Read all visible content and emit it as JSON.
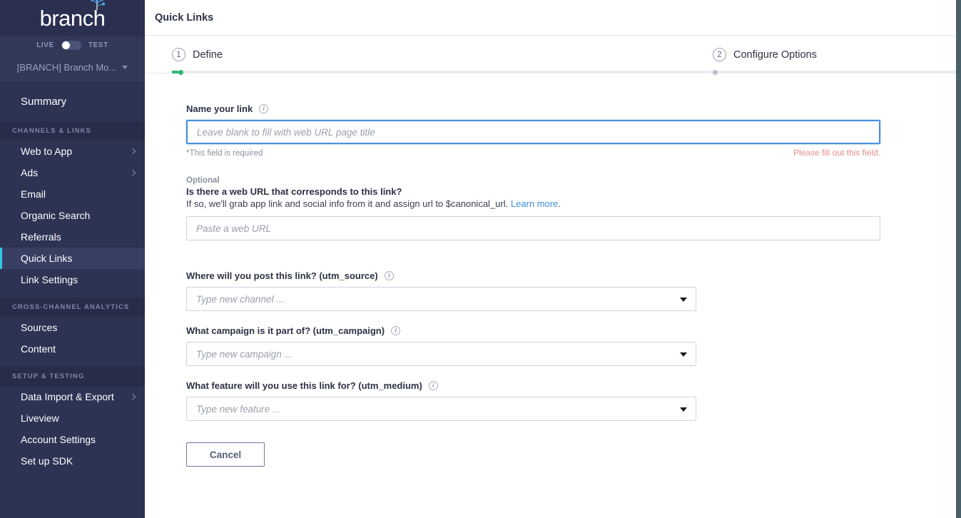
{
  "brand": {
    "logo_text": "branch",
    "accent_color": "#2ec7e4",
    "sidebar_bg": "#2d3353"
  },
  "sidebar": {
    "env_toggle": {
      "left_label": "LIVE",
      "right_label": "TEST",
      "state": "LIVE"
    },
    "account": {
      "label": "[BRANCH] Branch Mo...",
      "icon": "chevron-down-icon"
    },
    "top_items": [
      {
        "label": "Summary",
        "active": false,
        "expandable": false
      }
    ],
    "sections": [
      {
        "title": "CHANNELS & LINKS",
        "items": [
          {
            "label": "Web to App",
            "active": false,
            "expandable": true
          },
          {
            "label": "Ads",
            "active": false,
            "expandable": true
          },
          {
            "label": "Email",
            "active": false,
            "expandable": false
          },
          {
            "label": "Organic Search",
            "active": false,
            "expandable": false
          },
          {
            "label": "Referrals",
            "active": false,
            "expandable": false
          },
          {
            "label": "Quick Links",
            "active": true,
            "expandable": false
          },
          {
            "label": "Link Settings",
            "active": false,
            "expandable": false
          }
        ]
      },
      {
        "title": "CROSS-CHANNEL ANALYTICS",
        "items": [
          {
            "label": "Sources",
            "active": false,
            "expandable": false
          },
          {
            "label": "Content",
            "active": false,
            "expandable": false
          }
        ]
      },
      {
        "title": "SETUP & TESTING",
        "items": [
          {
            "label": "Data Import & Export",
            "active": false,
            "expandable": true
          },
          {
            "label": "Liveview",
            "active": false,
            "expandable": false
          },
          {
            "label": "Account Settings",
            "active": false,
            "expandable": false
          },
          {
            "label": "Set up SDK",
            "active": false,
            "expandable": false
          }
        ]
      }
    ]
  },
  "topbar": {
    "title": "Quick Links"
  },
  "wizard": {
    "steps": [
      {
        "number": "1",
        "label": "Define",
        "state": "current",
        "dot_color": "#2bb673"
      },
      {
        "number": "2",
        "label": "Configure Options",
        "state": "upcoming",
        "dot_color": "#b9c0ca"
      }
    ],
    "progress_color": "#2bb673"
  },
  "form": {
    "name_field": {
      "label": "Name your link",
      "info_icon": "info-icon",
      "value": "",
      "placeholder": "Leave blank to fill with web URL page title",
      "required_note": "*This field is required",
      "error_message": "Please fill out this field.",
      "error_color": "#e88b8b",
      "focused": true
    },
    "web_url_field": {
      "optional_tag": "Optional",
      "question": "Is there a web URL that corresponds to this link?",
      "description_prefix": "If so, we'll grab app link and social info from it and assign url to $canonical_url.",
      "link_text": "Learn more",
      "description_suffix": ".",
      "value": "",
      "placeholder": "Paste a web URL"
    },
    "dropdowns": [
      {
        "label": "Where will you post this link? (utm_source)",
        "info_icon": "info-icon",
        "value": "",
        "placeholder": "Type new channel ..."
      },
      {
        "label": "What campaign is it part of? (utm_campaign)",
        "info_icon": "info-icon",
        "value": "",
        "placeholder": "Type new campaign ..."
      },
      {
        "label": "What feature will you use this link for? (utm_medium)",
        "info_icon": "info-icon",
        "value": "",
        "placeholder": "Type new feature ..."
      }
    ],
    "cancel_button": "Cancel"
  }
}
